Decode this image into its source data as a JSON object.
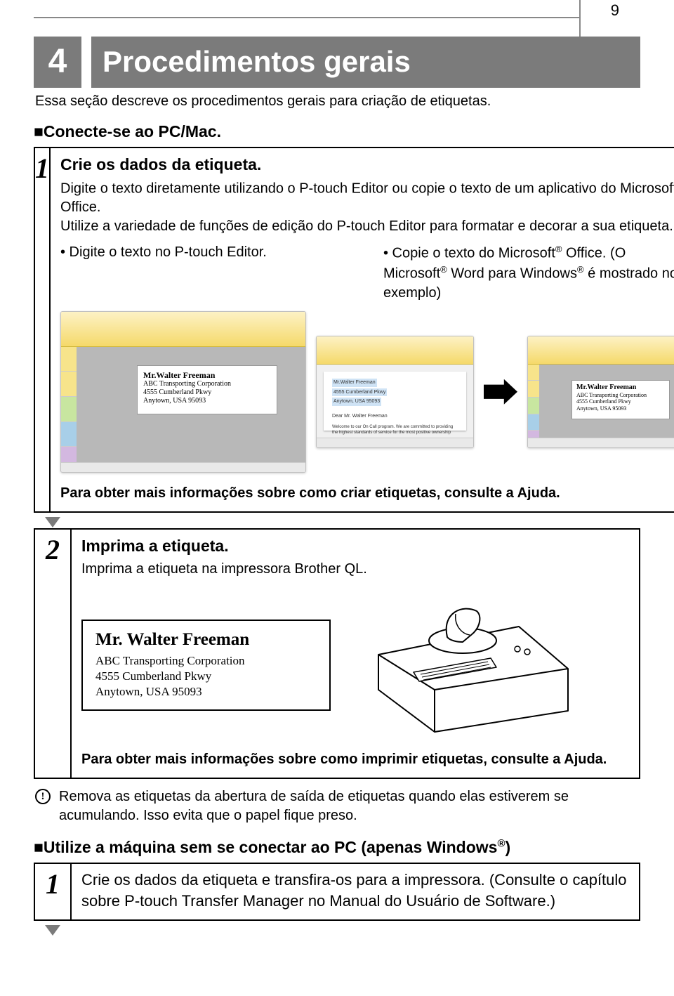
{
  "page_number": "9",
  "chapter_num": "4",
  "chapter_title": "Procedimentos gerais",
  "intro": "Essa seção descreve os procedimentos gerais para criação de etiquetas.",
  "section_a": "■Conecte-se ao PC/Mac.",
  "step1": {
    "num": "1",
    "title": "Crie os dados da etiqueta.",
    "line1_a": "Digite o texto diretamente utilizando o P-touch Editor ou copie o texto de um aplicativo do Microsoft",
    "line1_b": " Office.",
    "line2": "Utilize a variedade de funções de edição do P-touch Editor para formatar e decorar a sua etiqueta.",
    "bullet_left": "• Digite o texto no P-touch Editor.",
    "bullet_right_a": "• Copie o texto do Microsoft",
    "bullet_right_b": " Office. (O Microsoft",
    "bullet_right_c": " Word para Windows",
    "bullet_right_d": " é mostrado no exemplo)",
    "sample_name": "Mr.Walter Freeman",
    "sample_l1": "ABC Transporting Corporation",
    "sample_l2": "4555 Cumberland Pkwy",
    "sample_l3": "Anytown, USA 95093",
    "word_hl1": "Mr.Walter Freeman",
    "word_hl2": "4555 Cumberland Pkwy",
    "word_hl3": "Anytown, USA 95093",
    "word_greet": "Dear Mr. Walter Freeman",
    "word_body": "Welcome to our On Call program. We are committed to providing the highest standards of service for the most positive ownership",
    "foot": "Para obter mais informações sobre como criar etiquetas, consulte a Ajuda."
  },
  "step2": {
    "num": "2",
    "title": "Imprima a etiqueta.",
    "line1": "Imprima a etiqueta na impressora Brother QL.",
    "addr_name": "Mr. Walter Freeman",
    "addr_l1": "ABC Transporting Corporation",
    "addr_l2": "4555 Cumberland Pkwy",
    "addr_l3": "Anytown, USA 95093",
    "foot": "Para obter mais informações sobre como imprimir etiquetas, consulte a Ajuda."
  },
  "warning": "Remova as etiquetas da abertura de saída de etiquetas quando elas estiverem se acumulando. Isso evita que o papel fique preso.",
  "section_b_a": "■Utilize a máquina sem se conectar ao PC (apenas Windows",
  "section_b_b": ")",
  "step3": {
    "num": "1",
    "line1": "Crie os dados da etiqueta e transfira-os para a impressora. (Consulte o capítulo sobre P-touch Transfer Manager no Manual do Usuário de Software.)"
  }
}
